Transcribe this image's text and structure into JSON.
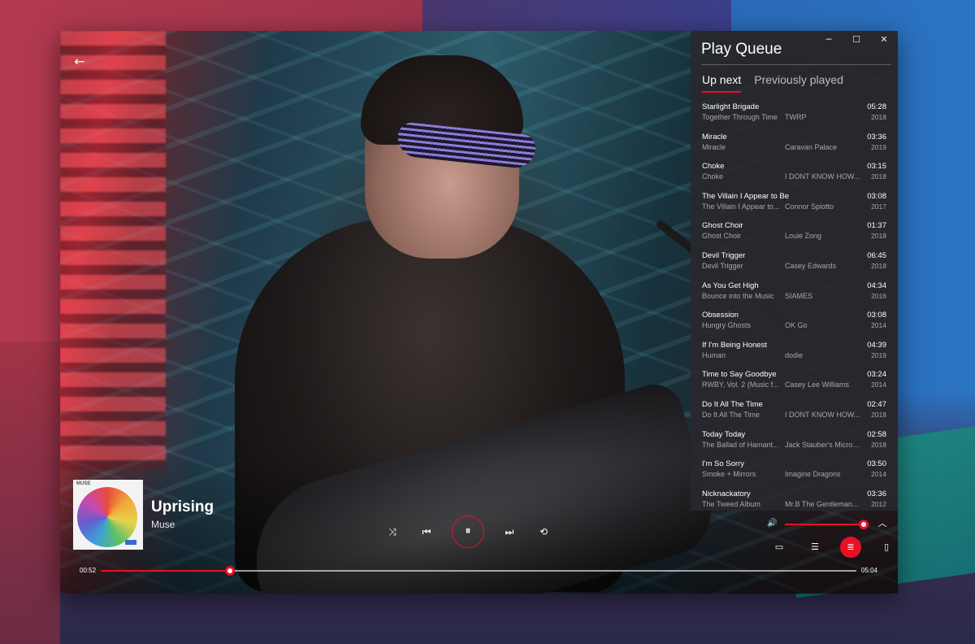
{
  "window": {
    "controls": {
      "minimize": "─",
      "maximize": "☐",
      "close": "✕"
    }
  },
  "nav": {
    "back_icon": "←"
  },
  "queue": {
    "title": "Play Queue",
    "tabs": [
      {
        "label": "Up next",
        "active": true
      },
      {
        "label": "Previously played",
        "active": false
      }
    ],
    "items": [
      {
        "title": "Starlight Brigade",
        "album": "Together Through Time",
        "artist": "TWRP",
        "duration": "05:28",
        "year": "2018"
      },
      {
        "title": "Miracle",
        "album": "Miracle",
        "artist": "Caravan Palace",
        "duration": "03:36",
        "year": "2019"
      },
      {
        "title": "Choke",
        "album": "Choke",
        "artist": "I DONT KNOW HOW...",
        "duration": "03:15",
        "year": "2018"
      },
      {
        "title": "The Villain I Appear to Be",
        "album": "The Villain I Appear to...",
        "artist": "Connor Spiotto",
        "duration": "03:08",
        "year": "2017"
      },
      {
        "title": "Ghost Choir",
        "album": "Ghost Choir",
        "artist": "Louie Zong",
        "duration": "01:37",
        "year": "2018"
      },
      {
        "title": "Devil Trigger",
        "album": "Devil Trigger",
        "artist": "Casey Edwards",
        "duration": "06:45",
        "year": "2018"
      },
      {
        "title": "As You Get High",
        "album": "Bounce into the Music",
        "artist": "SIAMES",
        "duration": "04:34",
        "year": "2016"
      },
      {
        "title": "Obsession",
        "album": "Hungry Ghosts",
        "artist": "OK Go",
        "duration": "03:08",
        "year": "2014"
      },
      {
        "title": "If I'm Being Honest",
        "album": "Human",
        "artist": "dodie",
        "duration": "04:39",
        "year": "2019"
      },
      {
        "title": "Time to Say Goodbye",
        "album": "RWBY, Vol. 2 (Music f...",
        "artist": "Casey Lee Williams",
        "duration": "03:24",
        "year": "2014"
      },
      {
        "title": "Do It All The Time",
        "album": "Do It All The Time",
        "artist": "I DONT KNOW HOW...",
        "duration": "02:47",
        "year": "2018"
      },
      {
        "title": "Today Today",
        "album": "The Ballad of Hamant...",
        "artist": "Jack Stauber's Microp...",
        "duration": "02:58",
        "year": "2018"
      },
      {
        "title": "I'm So Sorry",
        "album": "Smoke + Mirrors",
        "artist": "Imagine Dragons",
        "duration": "03:50",
        "year": "2014"
      },
      {
        "title": "Nicknackatory",
        "album": "The Tweed Album",
        "artist": "Mr.B The Gentleman...",
        "duration": "03:36",
        "year": "2012"
      }
    ]
  },
  "now_playing": {
    "album_art_text": "MUSE",
    "title": "Uprising",
    "artist": "Muse",
    "current_time": "00:52",
    "total_time": "05:04",
    "progress": 0.171
  },
  "controls": {
    "shuffle_icon": "⤨",
    "previous_icon": "⏮",
    "play_pause_icon": "⏸",
    "next_icon": "⏭",
    "repeat_icon": "⟲"
  },
  "volume": {
    "icon": "🔊",
    "level": 0.97,
    "expand_icon": "︿"
  },
  "utility": {
    "miniplayer_icon": "▭",
    "equalizer_icon": "☰",
    "queue_icon": "≣",
    "speaker_icon": "▯"
  },
  "colors": {
    "accent": "#e81123",
    "panel": "#28282c"
  }
}
